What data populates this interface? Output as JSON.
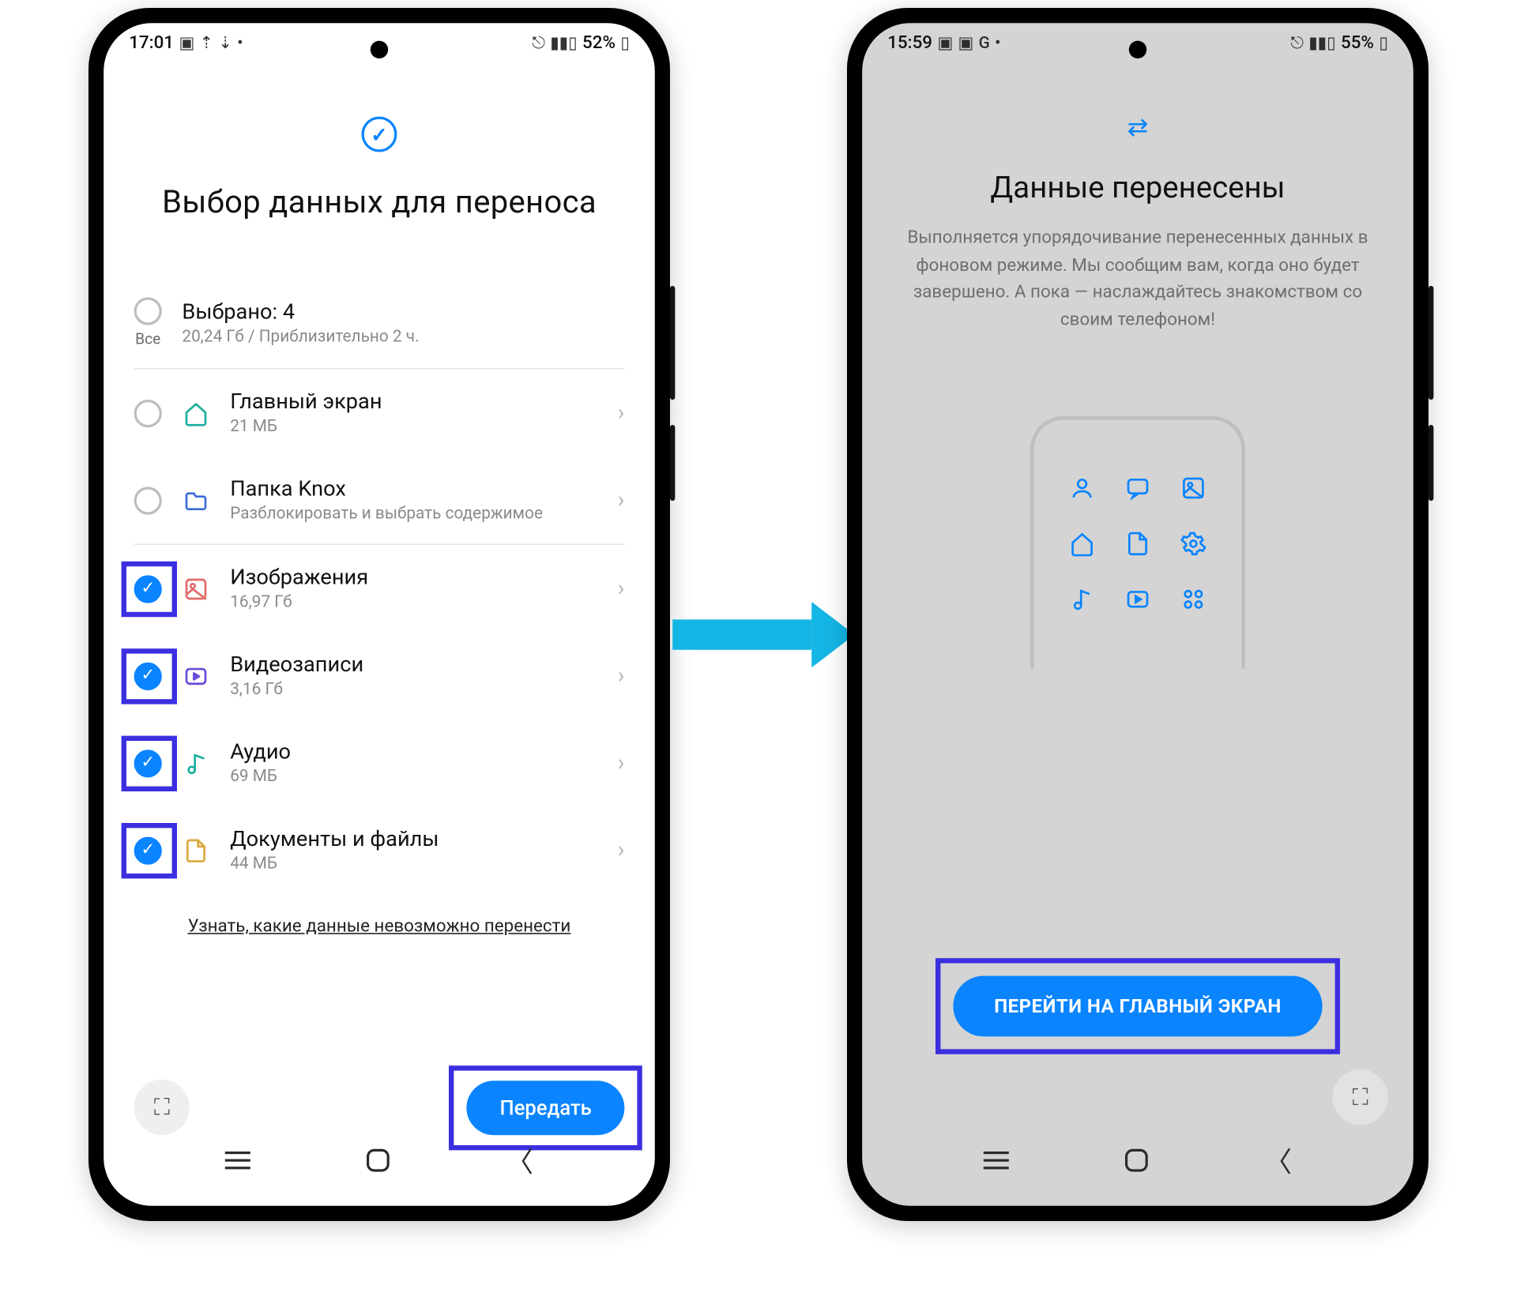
{
  "colors": {
    "accent": "#0a84ff",
    "highlight": "#3b2fe0",
    "arrow": "#14b6e6"
  },
  "left": {
    "statusbar": {
      "time": "17:01",
      "battery": "52%"
    },
    "header": {
      "title": "Выбор данных для переноса"
    },
    "all": {
      "label": "Все",
      "selected_title": "Выбрано: 4",
      "selected_sub": "20,24 Гб / Приблизительно 2 ч."
    },
    "items": [
      {
        "title": "Главный экран",
        "sub": "21 МБ",
        "checked": false,
        "highlighted": false,
        "icon": "home",
        "iconColor": "#1aae9f"
      },
      {
        "title": "Папка Knox",
        "sub": "Разблокировать и выбрать содержимое",
        "checked": false,
        "highlighted": false,
        "icon": "folder",
        "iconColor": "#3a6bd8"
      },
      {
        "title": "Изображения",
        "sub": "16,97 Гб",
        "checked": true,
        "highlighted": true,
        "icon": "image",
        "iconColor": "#e26a6a"
      },
      {
        "title": "Видеозаписи",
        "sub": "3,16 Гб",
        "checked": true,
        "highlighted": true,
        "icon": "video",
        "iconColor": "#6b4bd8"
      },
      {
        "title": "Аудио",
        "sub": "69 МБ",
        "checked": true,
        "highlighted": true,
        "icon": "audio",
        "iconColor": "#1aae9f"
      },
      {
        "title": "Документы и файлы",
        "sub": "44 МБ",
        "checked": true,
        "highlighted": true,
        "icon": "doc",
        "iconColor": "#d9a93a"
      }
    ],
    "info_link": "Узнать, какие данные невозможно перенести",
    "transfer_btn": "Передать"
  },
  "right": {
    "statusbar": {
      "time": "15:59",
      "battery": "55%"
    },
    "title": "Данные перенесены",
    "body": "Выполняется упорядочивание перенесенных данных в фоновом режиме. Мы сообщим вам, когда оно будет завершено. А пока — наслаждайтесь знакомством со своим телефоном!",
    "cta": "ПЕРЕЙТИ НА ГЛАВНЫЙ ЭКРАН"
  }
}
